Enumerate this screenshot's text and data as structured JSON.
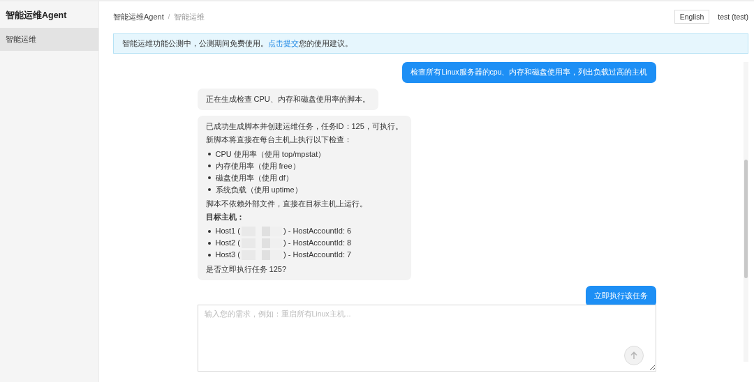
{
  "sidebar": {
    "title": "智能运维Agent",
    "items": [
      {
        "label": "智能运维",
        "selected": true
      }
    ]
  },
  "breadcrumb": [
    "智能运维Agent",
    "智能运维"
  ],
  "breadcrumb_separator": "/",
  "header": {
    "language_button": "English",
    "user": "test (test)"
  },
  "notice": {
    "before": "智能运维功能公测中，公测期间免费使用。",
    "link": "点击提交",
    "after": "您的使用建议。"
  },
  "messages": [
    {
      "kind": "user",
      "text": "检查所有Linux服务器的cpu、内存和磁盘使用率，列出负载过高的主机"
    },
    {
      "kind": "assistant",
      "blocks": [
        {
          "kind": "p",
          "text": "正在生成检查 CPU、内存和磁盘使用率的脚本。"
        }
      ]
    },
    {
      "kind": "assistant",
      "blocks": [
        {
          "kind": "p",
          "text": "已成功生成脚本并创建运维任务，任务ID：125，可执行。"
        },
        {
          "kind": "p",
          "text": "新脚本将直接在每台主机上执行以下检查："
        },
        {
          "kind": "ul",
          "items": [
            "CPU 使用率（使用 top/mpstat）",
            "内存使用率（使用 free）",
            "磁盘使用率（使用 df）",
            "系统负载（使用 uptime）"
          ]
        },
        {
          "kind": "p",
          "text": "脚本不依赖外部文件，直接在目标主机上运行。"
        },
        {
          "kind": "h",
          "text": "目标主机："
        },
        {
          "kind": "hosts",
          "items": [
            {
              "prefix": "Host1 (",
              "suffix": ") - HostAccountId: 6"
            },
            {
              "prefix": "Host2 (",
              "suffix": ") - HostAccountId: 8"
            },
            {
              "prefix": "Host3 (",
              "suffix": ") - HostAccountId: 7"
            }
          ]
        },
        {
          "kind": "p",
          "text": "是否立即执行任务 125?"
        }
      ]
    },
    {
      "kind": "user",
      "text": "立即执行该任务"
    }
  ],
  "input": {
    "placeholder": "输入您的需求，例如：重启所有Linux主机..."
  }
}
